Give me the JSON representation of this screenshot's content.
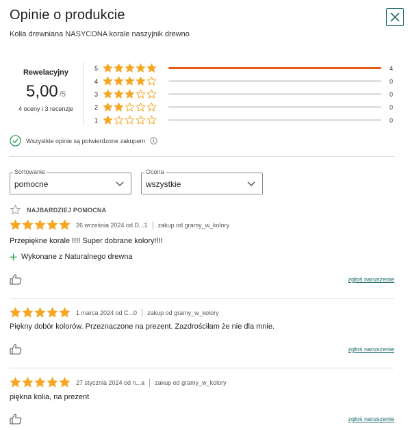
{
  "header": {
    "title": "Opinie o produkcie",
    "product_name": "Kolia drewniana NASYCONA korale naszyjnik drewno",
    "close_icon": "close-icon"
  },
  "summary": {
    "label": "Rewelacyjny",
    "average": "5,00",
    "scale": "/5",
    "count": "4 oceny i 3 recenzje"
  },
  "distribution": [
    {
      "stars": "5",
      "count": "4",
      "fraction": 1.0
    },
    {
      "stars": "4",
      "count": "0",
      "fraction": 0
    },
    {
      "stars": "3",
      "count": "0",
      "fraction": 0
    },
    {
      "stars": "2",
      "count": "0",
      "fraction": 0
    },
    {
      "stars": "1",
      "count": "0",
      "fraction": 0
    }
  ],
  "verified_text": "Wszystkie opinie są potwierdzone zakupem",
  "filters": {
    "sort": {
      "label": "Sortowanie",
      "value": "pomocne"
    },
    "rating": {
      "label": "Ocena",
      "value": "wszystkie"
    }
  },
  "most_helpful_label": "NAJBARDZIEJ POMOCNA",
  "reviews": [
    {
      "rating": 5,
      "date_author": "26 września 2024 od D...1",
      "purchase": "zakup od gramy_w_kolory",
      "text": "Przepiękne korale !!!! Super dobrane kolory!!!!",
      "pro": "Wykonane z Naturalnego drewna",
      "report_label": "zgłoś naruszenie"
    },
    {
      "rating": 5,
      "date_author": "1 marca 2024 od C...0",
      "purchase": "zakup od gramy_w_kolory",
      "text": "Piękny dobór kolorów. Przeznaczone na prezent. Zazdrościłam że nie dla mnie.",
      "report_label": "zgłoś naruszenie"
    },
    {
      "rating": 5,
      "date_author": "27 stycznia 2024 od n...a",
      "purchase": "zakup od gramy_w_kolory",
      "text": "piękna kolia, na prezent",
      "report_label": "zgłoś naruszenie"
    }
  ],
  "colors": {
    "star": "#f5a623",
    "accent_bar": "#e65a14",
    "link": "#1e6b6b",
    "check": "#2e9e5b",
    "pro_plus": "#2e9e5b"
  }
}
